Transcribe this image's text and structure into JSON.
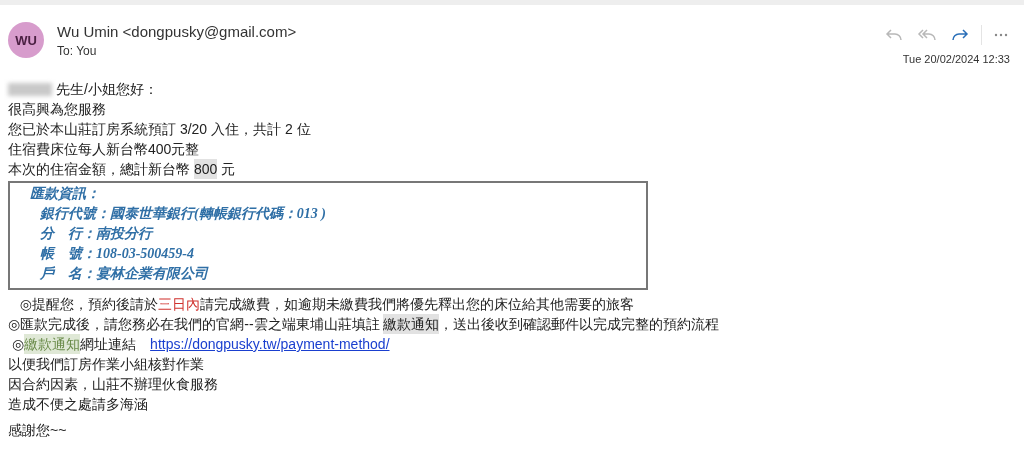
{
  "sender": {
    "initials": "WU",
    "name": "Wu Umin <dongpusky@gmail.com>",
    "to": "To:  You",
    "date": "Tue 20/02/2024 12:33"
  },
  "actions": [
    {
      "kind": "reply",
      "disabled": true
    },
    {
      "kind": "reply-all",
      "disabled": true
    },
    {
      "kind": "forward",
      "disabled": false
    },
    {
      "kind": "more",
      "disabled": false
    }
  ],
  "greeting": {
    "redacted": true,
    "text": "先生/小姐您好："
  },
  "lines_top": [
    [
      {
        "kind": "plain",
        "text": "很高興為您服務"
      }
    ],
    [
      {
        "kind": "plain",
        "text": "您已於本山莊訂房系統預訂 3/20 入住，共計 2 位"
      }
    ],
    [
      {
        "kind": "plain",
        "text": "住宿費床位每人新台幣400元整"
      }
    ],
    [
      {
        "kind": "plain",
        "text": "本次的住宿金額，總計新台幣 "
      },
      {
        "kind": "gray",
        "text": "800"
      },
      {
        "kind": "plain",
        "text": " 元"
      }
    ]
  ],
  "remittance": {
    "title": "匯款資訊：",
    "rows": [
      "銀行代號：國泰世華銀行(轉帳銀行代碼：013 )",
      "分　行：南投分行",
      "帳　號：108-03-500459-4",
      "戶　名：宴林企業有限公司"
    ]
  },
  "lines_bottom": [
    [
      {
        "kind": "plain",
        "text": "   ◎提醒您，預約後請於"
      },
      {
        "kind": "red",
        "text": "三日內"
      },
      {
        "kind": "plain",
        "text": "請完成繳費，如逾期未繳費我們將優先釋出您的床位給其他需要的旅客"
      }
    ],
    [
      {
        "kind": "plain",
        "text": "◎匯款完成後，請您務必在我們的官網--雲之端東埔山莊填註 "
      },
      {
        "kind": "gray",
        "text": "繳款通知"
      },
      {
        "kind": "plain",
        "text": "，送出後收到確認郵件以完成完整的預約流程"
      }
    ],
    [
      {
        "kind": "plain",
        "text": " ◎"
      },
      {
        "kind": "green",
        "text": "繳款通知"
      },
      {
        "kind": "plain",
        "text": "網址連結　"
      },
      {
        "kind": "link",
        "text": "https://dongpusky.tw/payment-method/"
      }
    ],
    [
      {
        "kind": "plain",
        "text": "以便我們訂房作業小組核對作業"
      }
    ],
    [
      {
        "kind": "plain",
        "text": "因合約因素，山莊不辦理伙食服務"
      }
    ],
    [
      {
        "kind": "plain",
        "text": "造成不便之處請多海涵"
      }
    ]
  ],
  "closing": "感謝您~~"
}
